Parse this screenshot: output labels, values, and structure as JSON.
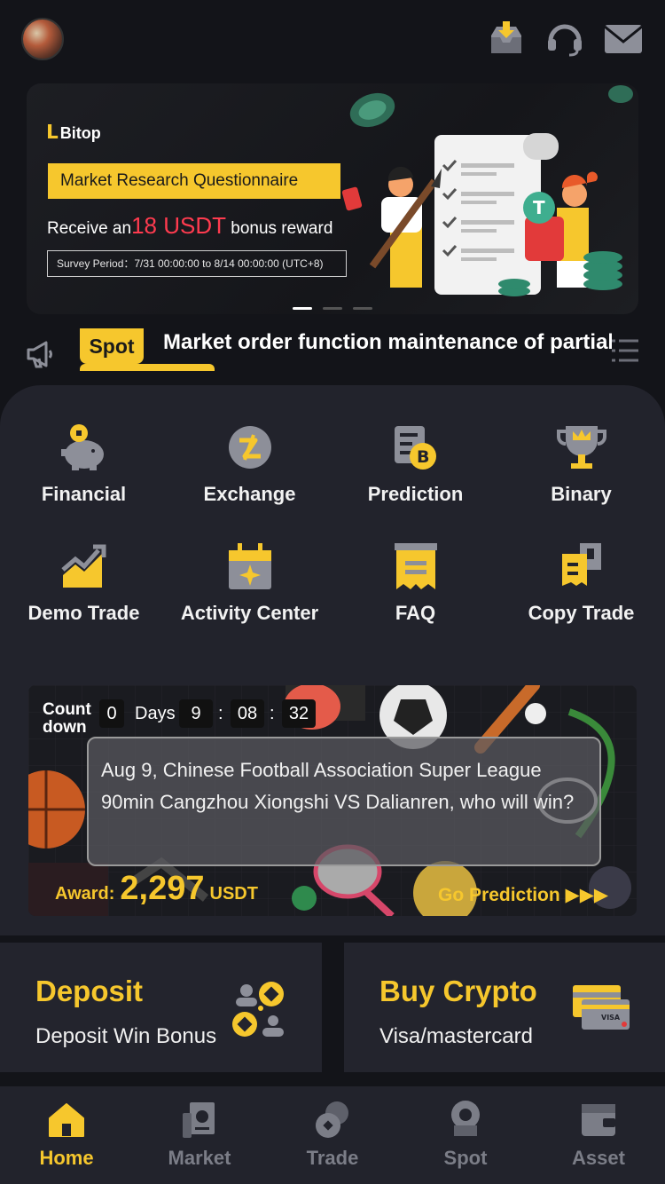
{
  "colors": {
    "accent": "#f6c72d",
    "background": "#131419",
    "panel": "#22232c",
    "highlight_red": "#ff3b4f",
    "inactive": "#7b7d87"
  },
  "header": {
    "avatar_icon": "avatar-icon",
    "download_icon": "download-icon",
    "support_icon": "headset-icon",
    "mail_icon": "mail-icon"
  },
  "banner": {
    "brand": "Bitop",
    "title": "Market Research Questionnaire",
    "reward_prefix": "Receive an",
    "reward_amount": "18 USDT",
    "reward_suffix": "bonus reward",
    "period": "Survey Period：7/31 00:00:00 to 8/14 00:00:00 (UTC+8)",
    "active_slide": 1,
    "slide_count": 3
  },
  "notice": {
    "tag": "Spot",
    "text": "Market order function maintenance of partial"
  },
  "grid": [
    {
      "label": "Financial",
      "icon": "piggy-bank-icon"
    },
    {
      "label": "Exchange",
      "icon": "exchange-icon"
    },
    {
      "label": "Prediction",
      "icon": "bitcoin-prediction-icon"
    },
    {
      "label": "Binary",
      "icon": "trophy-icon"
    },
    {
      "label": "Demo Trade",
      "icon": "trend-chart-icon"
    },
    {
      "label": "Activity Center",
      "icon": "calendar-star-icon"
    },
    {
      "label": "FAQ",
      "icon": "document-icon"
    },
    {
      "label": "Copy Trade",
      "icon": "copy-document-icon"
    }
  ],
  "prediction": {
    "countdown_label_1": "Count",
    "countdown_label_2": "down",
    "days": "0",
    "days_label": "Days",
    "hours": "9",
    "minutes": "08",
    "seconds": "32",
    "sep": ":",
    "question": "Aug 9, Chinese Football Association Super League 90min Cangzhou Xiongshi VS Dalianren, who will win?",
    "award_label": "Award:",
    "award_value": "2,297",
    "award_unit": "USDT",
    "cta": "Go Prediction ▶▶▶"
  },
  "deposit": {
    "title": "Deposit",
    "subtitle": "Deposit Win Bonus"
  },
  "buy": {
    "title": "Buy Crypto",
    "subtitle": "Visa/mastercard"
  },
  "nav": [
    {
      "label": "Home",
      "icon": "home-icon",
      "active": true
    },
    {
      "label": "Market",
      "icon": "market-icon",
      "active": false
    },
    {
      "label": "Trade",
      "icon": "trade-icon",
      "active": false
    },
    {
      "label": "Spot",
      "icon": "spot-icon",
      "active": false
    },
    {
      "label": "Asset",
      "icon": "wallet-icon",
      "active": false
    }
  ]
}
